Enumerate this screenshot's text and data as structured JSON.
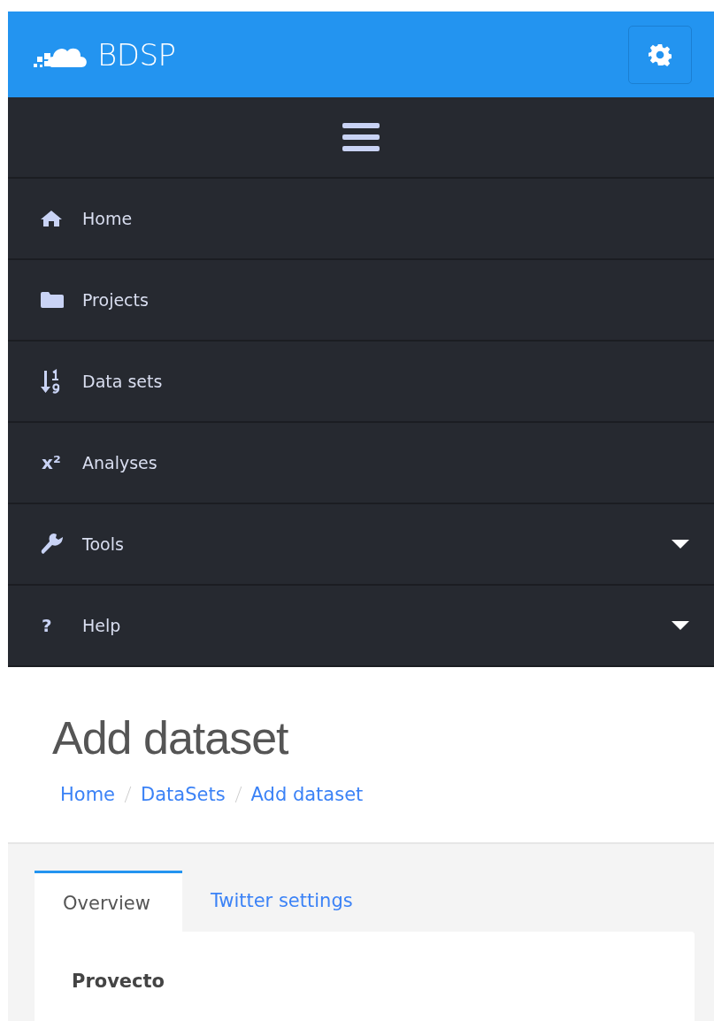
{
  "header": {
    "brand": "BDSP"
  },
  "menu": {
    "items": [
      {
        "label": "Home",
        "has_submenu": false
      },
      {
        "label": "Projects",
        "has_submenu": false
      },
      {
        "label": "Data sets",
        "has_submenu": false
      },
      {
        "label": "Analyses",
        "icon_text": "x²",
        "has_submenu": false
      },
      {
        "label": "Tools",
        "has_submenu": true
      },
      {
        "label": "Help",
        "icon_text": "?",
        "has_submenu": true
      }
    ]
  },
  "page": {
    "title": "Add dataset",
    "breadcrumb": [
      "Home",
      "DataSets",
      "Add dataset"
    ]
  },
  "tabs": [
    {
      "label": "Overview",
      "selected": true
    },
    {
      "label": "Twitter settings",
      "selected": false
    }
  ],
  "form": {
    "field_label": "Provecto"
  }
}
